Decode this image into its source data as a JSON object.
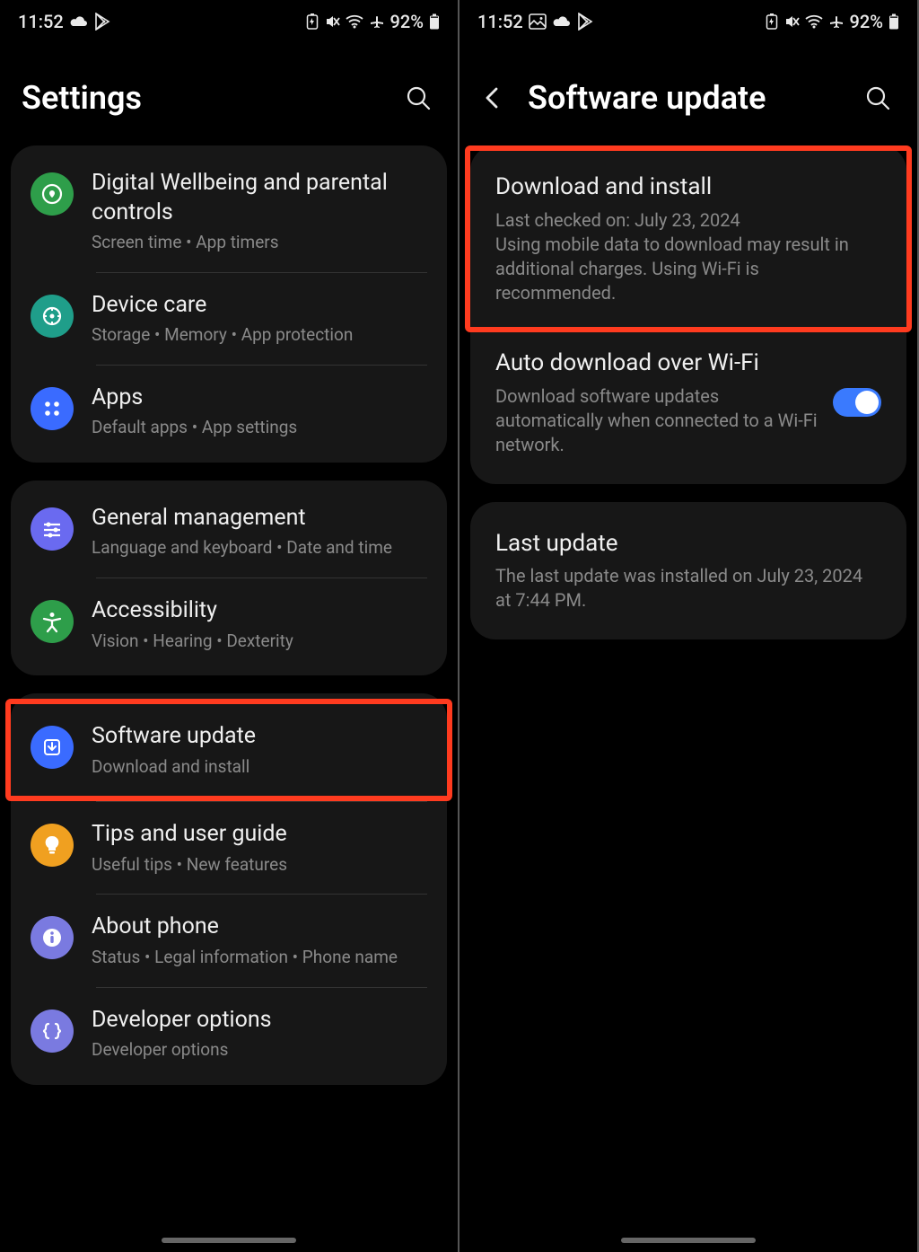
{
  "statusbar": {
    "time": "11:52",
    "battery_text": "92%"
  },
  "leftScreen": {
    "title": "Settings",
    "groups": [
      {
        "rows": [
          {
            "icon": "wellbeing",
            "color": "#2e9e4a",
            "title": "Digital Wellbeing and parental controls",
            "sub": "Screen time  •  App timers"
          },
          {
            "icon": "devicecare",
            "color": "#1f9e8a",
            "title": "Device care",
            "sub": "Storage  •  Memory  •  App protection"
          },
          {
            "icon": "apps",
            "color": "#3a6bff",
            "title": "Apps",
            "sub": "Default apps  •  App settings"
          }
        ]
      },
      {
        "rows": [
          {
            "icon": "general",
            "color": "#6a6af0",
            "title": "General management",
            "sub": "Language and keyboard  •  Date and time"
          },
          {
            "icon": "a11y",
            "color": "#2e9e4a",
            "title": "Accessibility",
            "sub": "Vision  •  Hearing  •  Dexterity"
          }
        ]
      },
      {
        "highlightIndex": 0,
        "rows": [
          {
            "icon": "update",
            "color": "#3a6bff",
            "title": "Software update",
            "sub": "Download and install"
          },
          {
            "icon": "tips",
            "color": "#f0a020",
            "title": "Tips and user guide",
            "sub": "Useful tips  •  New features"
          },
          {
            "icon": "about",
            "color": "#7a7ae0",
            "title": "About phone",
            "sub": "Status  •  Legal information  •  Phone name"
          },
          {
            "icon": "dev",
            "color": "#7a7ae0",
            "title": "Developer options",
            "sub": "Developer options"
          }
        ]
      }
    ]
  },
  "rightScreen": {
    "title": "Software update",
    "groups": [
      {
        "highlightIndex": 0,
        "rows": [
          {
            "title": "Download and install",
            "sub": "Last checked on: July 23, 2024\nUsing mobile data to download may result in additional charges. Using Wi-Fi is recommended."
          },
          {
            "title": "Auto download over Wi-Fi",
            "sub": "Download software updates automatically when connected to a Wi-Fi network.",
            "toggle": true
          }
        ]
      },
      {
        "rows": [
          {
            "title": "Last update",
            "sub": "The last update was installed on July 23, 2024 at 7:44 PM."
          }
        ]
      }
    ]
  }
}
